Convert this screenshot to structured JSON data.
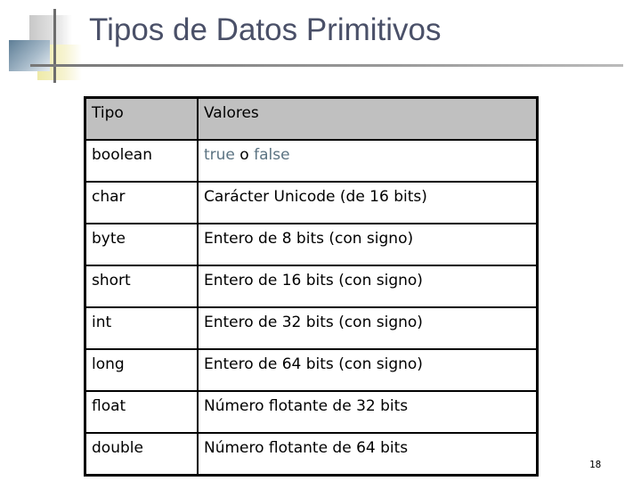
{
  "slide": {
    "title": "Tipos de Datos Primitivos",
    "page_number": "18"
  },
  "table": {
    "headers": [
      "Tipo",
      "Valores"
    ],
    "boolean_row": {
      "type": "boolean",
      "true_kw": "true",
      "sep": " o ",
      "false_kw": "false"
    },
    "rows": [
      {
        "type": "char",
        "value": "Carácter Unicode (de 16 bits)"
      },
      {
        "type": "byte",
        "value": "Entero de 8 bits (con signo)"
      },
      {
        "type": "short",
        "value": "Entero de 16 bits (con signo)"
      },
      {
        "type": "int",
        "value": "Entero de 32 bits (con signo)"
      },
      {
        "type": "long",
        "value": "Entero de 64 bits (con signo)"
      },
      {
        "type": "float",
        "value": "Número flotante de 32 bits"
      },
      {
        "type": "double",
        "value": "Número flotante de 64 bits"
      }
    ]
  },
  "colors": {
    "header_bg": "#c0c0c0",
    "keyword": "#5b7382",
    "title": "#4a5068"
  }
}
